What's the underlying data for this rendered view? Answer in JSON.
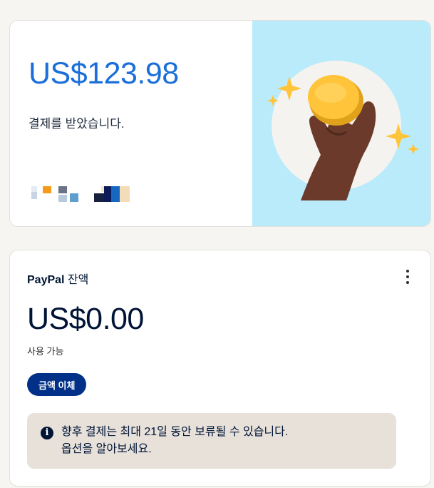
{
  "payment_received": {
    "amount": "US$123.98",
    "message": "결제를 받았습니다."
  },
  "balance": {
    "brand": "PayPal",
    "title_suffix": " 잔액",
    "amount": "US$0.00",
    "available_label": "사용 가능",
    "transfer_button": "금액 이체",
    "menu_icon": "kebab-menu-icon",
    "notice_icon": "info-icon",
    "notice_line1": "향후 결제는 최대 21일 동안 보류될 수 있습니다.",
    "notice_line2": "옵션을 알아보세요."
  },
  "colors": {
    "accent": "#1a6fd8",
    "button": "#003087",
    "illustration_bg": "#b9ebfa",
    "notice_bg": "#e7e1da",
    "coin": "#ffc439"
  }
}
